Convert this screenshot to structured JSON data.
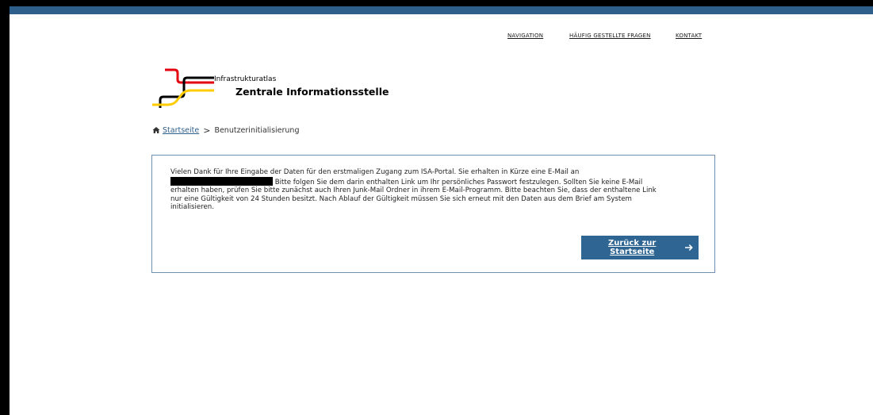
{
  "topnav": {
    "navigation": "NAVIGATION",
    "faq": "HÄUFIG GESTELLTE FRAGEN",
    "contact": "KONTAKT"
  },
  "logo": {
    "small_text": "Infrastrukturatlas",
    "big_text": "Zentrale Informationsstelle"
  },
  "breadcrumb": {
    "home_icon": "home-icon",
    "home_label": "Startseite",
    "separator": ">",
    "current": "Benutzerinitialisierung"
  },
  "message": {
    "line1": "Vielen Dank für Ihre Eingabe der Daten für den erstmaligen Zugang zum ISA-Portal. Sie erhalten in Kürze eine E-Mail an",
    "line2_after_redaction": " Bitte folgen Sie dem darin enthalten Link um Ihr persönliches Passwort festzulegen. Sollten Sie keine E-Mail",
    "line3": "erhalten haben, prüfen Sie bitte zunächst auch Ihren Junk-Mail Ordner in ihrem E-Mail-Programm. Bitte beachten Sie, dass der enthaltene Link",
    "line4": "nur eine Gültigkeit von 24 Stunden besitzt. Nach Ablauf der Gültigkeit müssen Sie sich erneut mit den Daten aus dem Brief am System",
    "line5": "initialisieren."
  },
  "button": {
    "label": "Zurück zur Startseite",
    "icon": "arrow-right-icon"
  },
  "colors": {
    "accent": "#2e5f8a",
    "button": "#2e6592",
    "box_border": "#6f8fb0",
    "logo_red": "#e3000f",
    "logo_yellow": "#ffcc00",
    "logo_black": "#000000"
  }
}
